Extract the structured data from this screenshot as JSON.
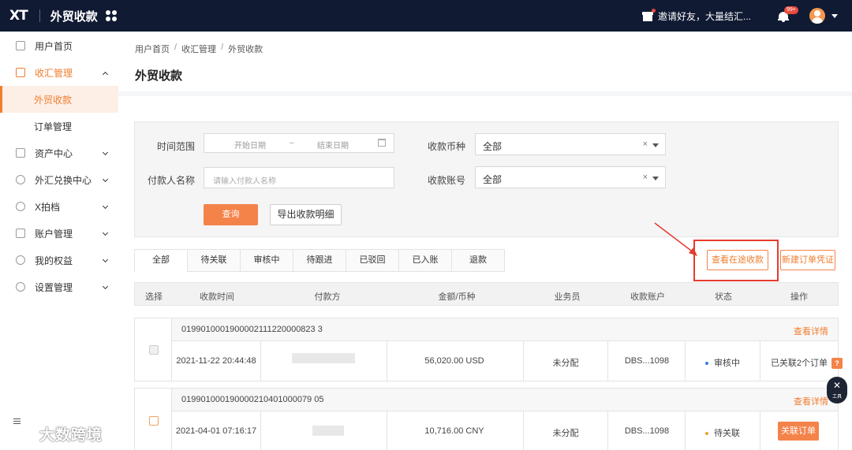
{
  "app": {
    "logo": "XT",
    "title": "外贸收款"
  },
  "topbar": {
    "invite_text": "邀请好友，大量结汇...",
    "notification_badge": "99+"
  },
  "sidebar": {
    "items": [
      {
        "label": "用户首页"
      },
      {
        "label": "收汇管理",
        "expanded": true,
        "children": [
          {
            "label": "外贸收款",
            "active": true
          },
          {
            "label": "订单管理"
          }
        ]
      },
      {
        "label": "资产中心"
      },
      {
        "label": "外汇兑换中心"
      },
      {
        "label": "X拍档"
      },
      {
        "label": "账户管理"
      },
      {
        "label": "我的权益"
      },
      {
        "label": "设置管理"
      }
    ]
  },
  "breadcrumb": [
    "用户首页",
    "收汇管理",
    "外贸收款"
  ],
  "breadcrumb_sep": "/",
  "page_title": "外贸收款",
  "filters": {
    "time_range_label": "时间范围",
    "start_placeholder": "开始日期",
    "range_sep": "–",
    "end_placeholder": "结束日期",
    "payer_label": "付款人名称",
    "payer_placeholder": "请输入付款人名称",
    "currency_label": "收款币种",
    "currency_value": "全部",
    "account_label": "收款账号",
    "account_value": "全部",
    "clear_icon": "×",
    "query_button": "查询",
    "export_button": "导出收款明细"
  },
  "tabs": [
    "全部",
    "待关联",
    "审核中",
    "待跟进",
    "已驳回",
    "已入账",
    "退款"
  ],
  "actions": {
    "view_in_transit": "查看在途收款",
    "new_voucher": "新建订单凭证"
  },
  "table": {
    "headers": [
      "选择",
      "收款时间",
      "付款方",
      "金额/币种",
      "业务员",
      "收款账户",
      "状态",
      "操作"
    ],
    "orders": [
      {
        "order_id": "0199010001900002111220000823 3",
        "detail_link": "查看详情",
        "time": "2021-11-22 20:44:48",
        "amount": "56,020.00 USD",
        "salesperson": "未分配",
        "account": "DBS...1098",
        "status": "审核中",
        "status_color": "#3a7be0",
        "operation": "已关联2个订单"
      },
      {
        "order_id": "019901000190000210401000079 05",
        "detail_link": "查看详情",
        "time": "2021-04-01 07:16:17",
        "amount": "10,716.00 CNY",
        "salesperson": "未分配",
        "account": "DBS...1098",
        "status": "待关联",
        "status_color": "#f0a030",
        "operation": "关联订单"
      }
    ]
  },
  "floating": {
    "help": "?",
    "tool_label": "工具"
  },
  "watermark": "大数跨境",
  "colors": {
    "accent": "#f4834a",
    "topbar": "#101a33",
    "annotation": "#e53b2f"
  }
}
